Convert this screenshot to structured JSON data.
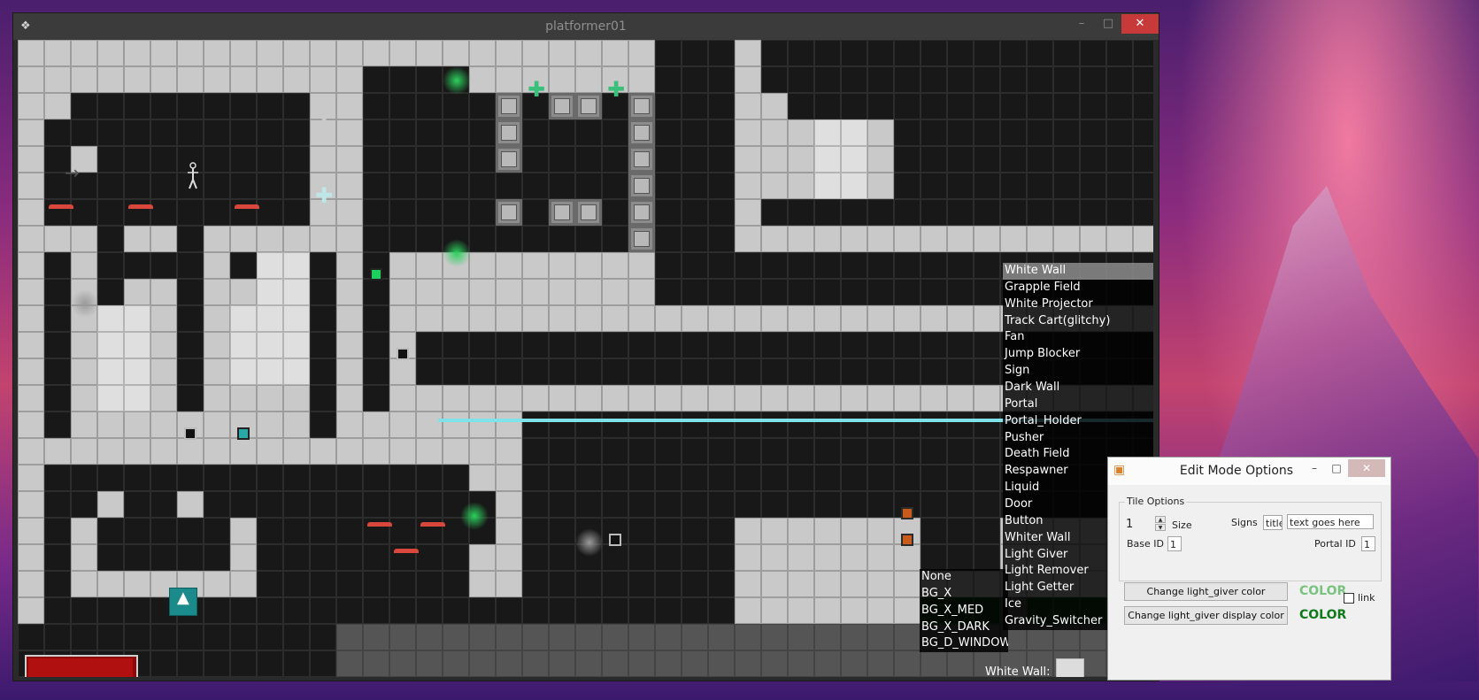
{
  "window": {
    "title": "platformer01",
    "min_label": "–",
    "max_label": "□",
    "close_label": "✕",
    "app_icon": "gamepad-icon"
  },
  "tile_menu": {
    "items": [
      "White Wall",
      "Grapple Field",
      "White Projector",
      "Track Cart(glitchy)",
      "Fan",
      "Jump Blocker",
      "Sign",
      "Dark Wall",
      "Portal",
      "Portal_Holder",
      "Pusher",
      "Death Field",
      "Respawner",
      "Liquid",
      "Door",
      "Button",
      "Whiter Wall",
      "Light Giver",
      "Light Remover",
      "Light Getter",
      "Ice",
      "Gravity_Switcher"
    ],
    "selected_index": 0
  },
  "bg_menu": {
    "items": [
      "None",
      "BG_X",
      "BG_X_MED",
      "BG_X_DARK",
      "BG_D_WINDOW"
    ]
  },
  "status": {
    "label": "White Wall:"
  },
  "dialog": {
    "title": "Edit Mode Options",
    "min_label": "–",
    "max_label": "□",
    "close_label": "✕",
    "group_label": "Tile Options",
    "size_value": "1",
    "size_label": "Size",
    "signs_label": "Signs",
    "sign_title_value": "title",
    "sign_text_value": "text goes here",
    "base_id_label": "Base ID",
    "base_id_value": "1",
    "portal_id_label": "Portal ID",
    "portal_id_value": "1",
    "change_color_button": "Change light_giver color",
    "change_display_color_button": "Change light_giver display color",
    "color_label_1": "COLOR",
    "color_label_2": "COLOR",
    "link_label": "link",
    "color_1_hex": "#79c27f",
    "color_2_hex": "#0f7a1a"
  },
  "health": {
    "fraction": 1.0
  }
}
